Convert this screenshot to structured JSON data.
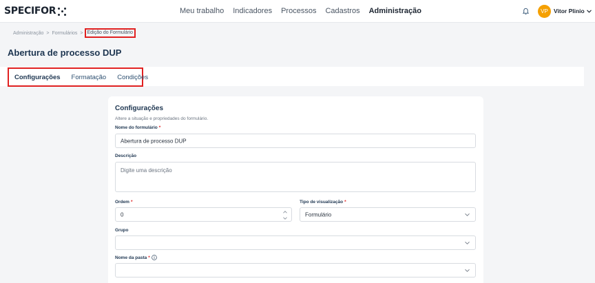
{
  "header": {
    "logo": "SPECIFOR",
    "nav": [
      {
        "label": "Meu trabalho",
        "active": false
      },
      {
        "label": "Indicadores",
        "active": false
      },
      {
        "label": "Processos",
        "active": false
      },
      {
        "label": "Cadastros",
        "active": false
      },
      {
        "label": "Administração",
        "active": true
      }
    ],
    "avatar_initials": "VP",
    "user_name": "Vitor Plinio",
    "accent_color": "#f5a000"
  },
  "breadcrumb": {
    "items": [
      "Administração",
      "Formulários"
    ],
    "separator": ">",
    "current": "Edição do Formulário"
  },
  "page": {
    "title": "Abertura de processo DUP"
  },
  "tabs": [
    {
      "label": "Configurações",
      "active": true
    },
    {
      "label": "Formatação",
      "active": false
    },
    {
      "label": "Condições",
      "active": false
    }
  ],
  "form": {
    "title": "Configurações",
    "subtitle": "Altere a situação e propriedades do formulário.",
    "required_mark": "*",
    "name_label": "Nome do formulário",
    "name_value": "Abertura de processo DUP",
    "description_label": "Descrição",
    "description_placeholder": "Digite uma descrição",
    "order_label": "Ordem",
    "order_value": "0",
    "view_type_label": "Tipo de visualização",
    "view_type_value": "Formulário",
    "group_label": "Grupo",
    "group_value": "",
    "folder_label": "Nome da pasta",
    "folder_value": ""
  },
  "icons": [
    "bell-icon",
    "chevron-down-icon",
    "info-icon",
    "stepper-up-icon",
    "stepper-down-icon"
  ]
}
